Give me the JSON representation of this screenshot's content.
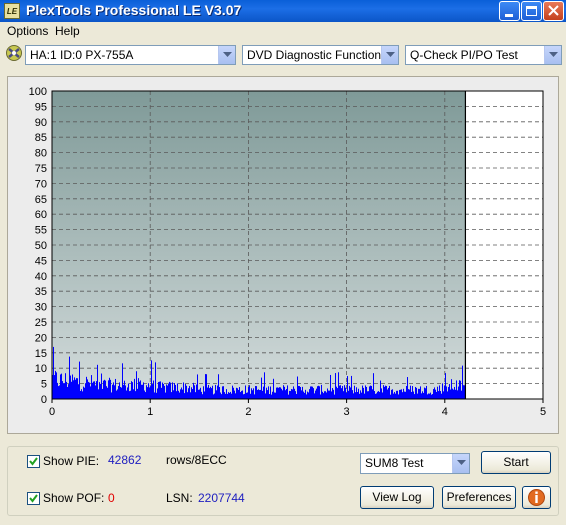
{
  "window": {
    "title": "PlexTools Professional LE V3.07",
    "app_icon_text": "LE"
  },
  "menu": [
    "Options",
    "Help"
  ],
  "toolbar": {
    "drive": "HA:1 ID:0  PX-755A",
    "function": "DVD Diagnostic Functions",
    "test": "Q-Check PI/PO Test"
  },
  "chart_data": {
    "type": "bar",
    "title": "",
    "xlabel": "",
    "ylabel": "",
    "xlim": [
      0,
      5
    ],
    "ylim": [
      0,
      100
    ],
    "x_ticks": [
      0,
      1,
      2,
      3,
      4,
      5
    ],
    "y_ticks": [
      0,
      5,
      10,
      15,
      20,
      25,
      30,
      35,
      40,
      45,
      50,
      55,
      60,
      65,
      70,
      75,
      80,
      85,
      90,
      95,
      100
    ],
    "grid": true,
    "scan_end": 4.21,
    "series": [
      {
        "name": "",
        "color": "#0000ff",
        "profile": [
          [
            0.0,
            9
          ],
          [
            0.1,
            8
          ],
          [
            0.2,
            8
          ],
          [
            0.3,
            7
          ],
          [
            0.4,
            7
          ],
          [
            0.5,
            6
          ],
          [
            0.6,
            6
          ],
          [
            0.7,
            6
          ],
          [
            0.8,
            6
          ],
          [
            0.9,
            6
          ],
          [
            1.0,
            6
          ],
          [
            1.1,
            5
          ],
          [
            1.2,
            5
          ],
          [
            1.3,
            5
          ],
          [
            1.4,
            5
          ],
          [
            1.5,
            4
          ],
          [
            1.6,
            4
          ],
          [
            1.7,
            4
          ],
          [
            1.8,
            4
          ],
          [
            1.9,
            4
          ],
          [
            2.0,
            4
          ],
          [
            2.1,
            4
          ],
          [
            2.2,
            4
          ],
          [
            2.3,
            4
          ],
          [
            2.4,
            4
          ],
          [
            2.5,
            4
          ],
          [
            2.6,
            4
          ],
          [
            2.7,
            4
          ],
          [
            2.8,
            4
          ],
          [
            2.9,
            4
          ],
          [
            3.0,
            4
          ],
          [
            3.1,
            4
          ],
          [
            3.2,
            4
          ],
          [
            3.3,
            4
          ],
          [
            3.4,
            4
          ],
          [
            3.5,
            4
          ],
          [
            3.6,
            4
          ],
          [
            3.7,
            4
          ],
          [
            3.8,
            4
          ],
          [
            3.9,
            4
          ],
          [
            4.0,
            5
          ],
          [
            4.1,
            6
          ],
          [
            4.21,
            5
          ]
        ]
      }
    ]
  },
  "panel": {
    "show_pie_label": "Show PIE:",
    "pie_value": "42862",
    "pie_unit": "rows/8ECC",
    "show_pof_label": "Show POF:",
    "pof_value": "0",
    "lsn_label": "LSN:",
    "lsn_value": "2207744",
    "mode_select": "SUM8 Test",
    "start_label": "Start",
    "view_log_label": "View Log",
    "preferences_label": "Preferences",
    "colors": {
      "pie": "#2020c0",
      "pof": "#e00000"
    }
  }
}
